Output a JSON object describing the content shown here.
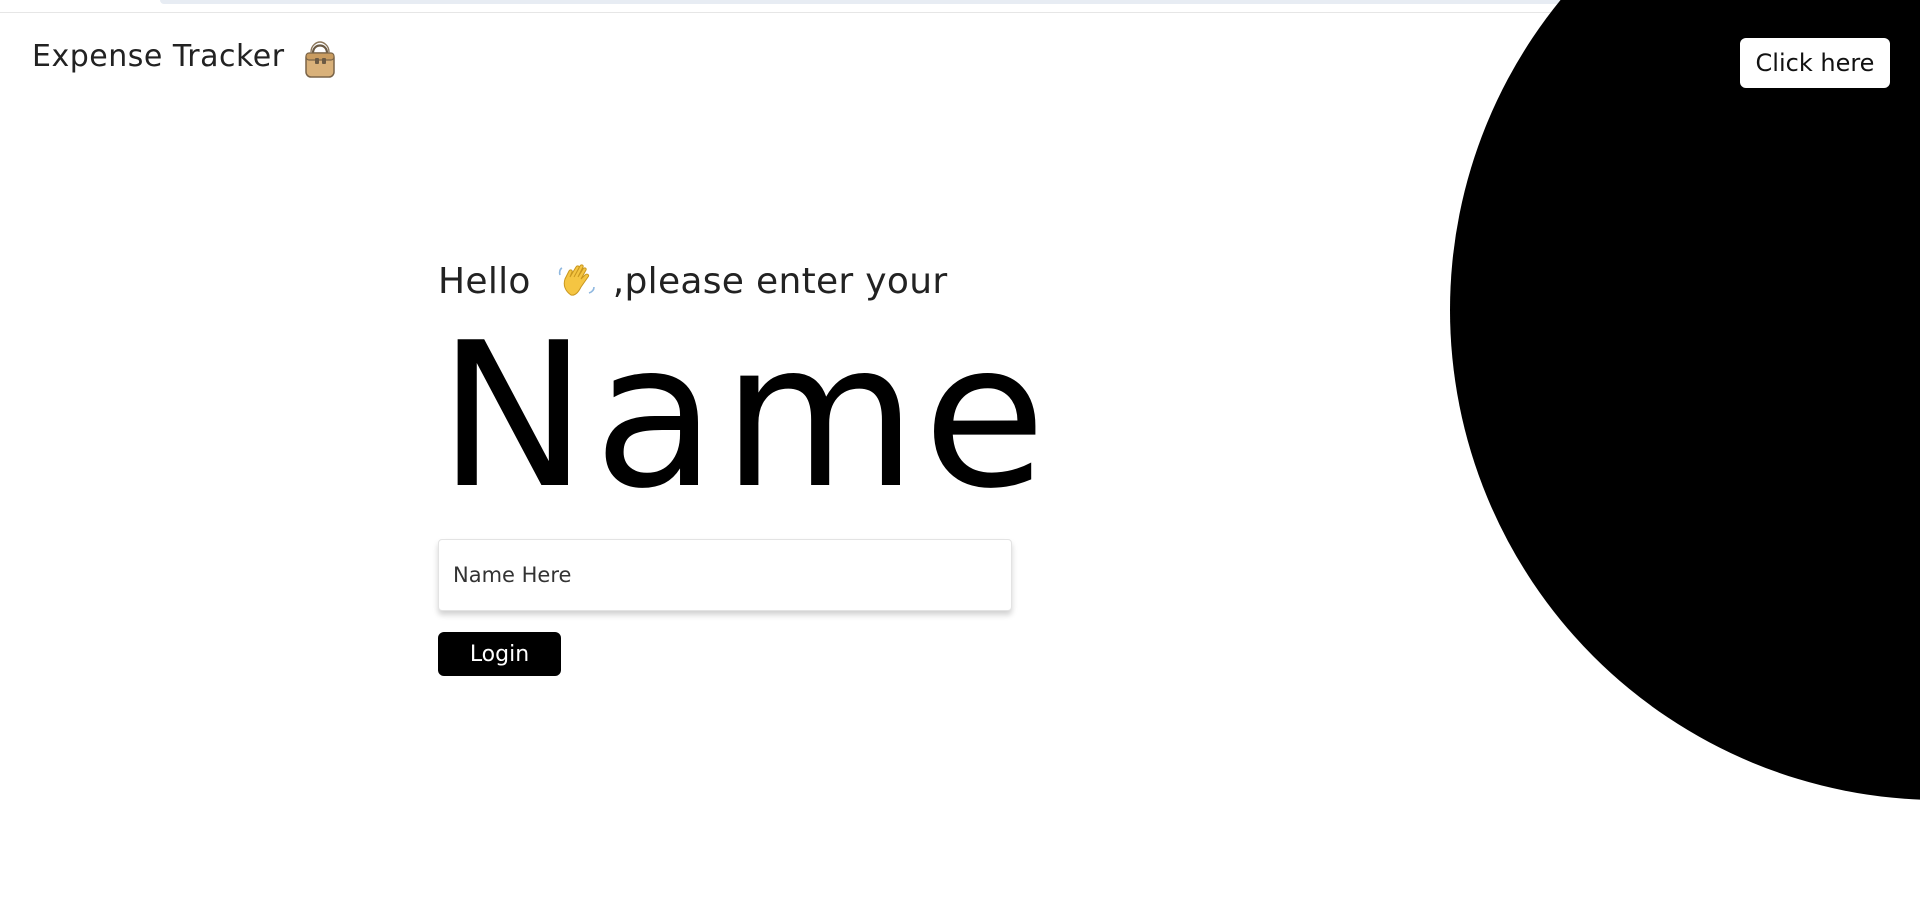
{
  "header": {
    "brand_title": "Expense Tracker",
    "brand_icon": "handbag-icon",
    "cta_label": "Click here"
  },
  "main": {
    "greeting_hello": "Hello",
    "greeting_icon": "waving-hand-icon",
    "greeting_rest": ",please enter your",
    "big_title": "Name"
  },
  "form": {
    "name_placeholder": "Name Here",
    "name_value": "",
    "login_label": "Login"
  },
  "colors": {
    "background": "#ffffff",
    "accent": "#000000",
    "text": "#222222"
  }
}
